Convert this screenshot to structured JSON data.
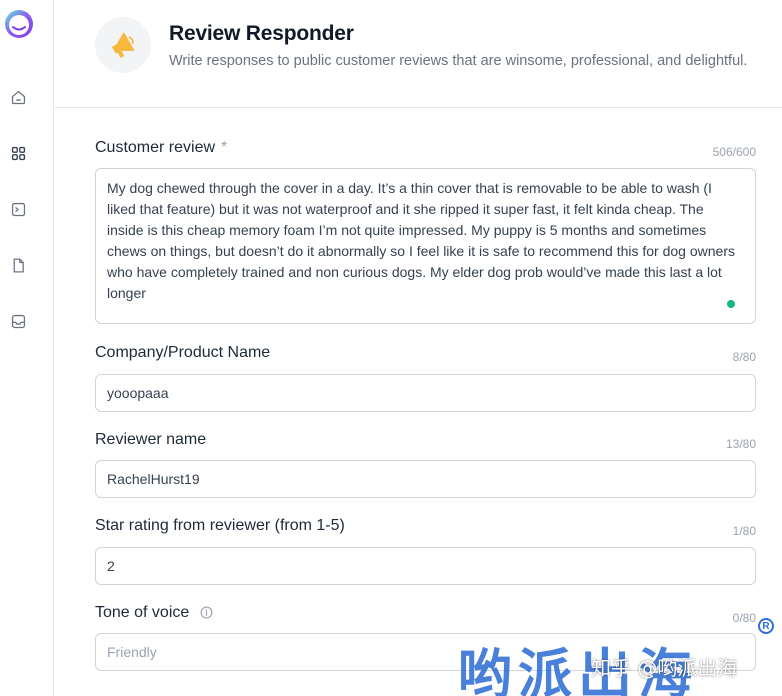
{
  "header": {
    "title": "Review Responder",
    "subtitle": "Write responses to public customer reviews that are winsome, professional, and delightful.",
    "app_icon": "megaphone-icon"
  },
  "sidebar": {
    "logo": "app-logo",
    "items": [
      {
        "icon": "home-icon"
      },
      {
        "icon": "grid-icon"
      },
      {
        "icon": "terminal-icon"
      },
      {
        "icon": "document-icon"
      },
      {
        "icon": "inbox-icon"
      }
    ]
  },
  "form": {
    "customer_review": {
      "label": "Customer review",
      "required_mark": "*",
      "counter": "506/600",
      "value": "My dog chewed through the cover in a day. It’s a thin cover that is removable to be able to wash (I liked that feature) but it was not waterproof and it she ripped it super fast, it felt kinda cheap. The inside is this cheap memory foam I’m not quite impressed. My puppy is 5 months and sometimes chews on things, but doesn’t do it abnormally so I feel like it is safe to recommend this for dog owners who have completely trained and non curious dogs. My elder dog prob would’ve made this last a lot longer"
    },
    "company": {
      "label": "Company/Product Name",
      "counter": "8/80",
      "value": "yooopaaa"
    },
    "reviewer": {
      "label": "Reviewer name",
      "counter": "13/80",
      "value": "RachelHurst19"
    },
    "rating": {
      "label": "Star rating from reviewer (from 1-5)",
      "counter": "1/80",
      "value": "2"
    },
    "tone": {
      "label": "Tone of voice",
      "counter": "0/80",
      "placeholder": "Friendly"
    }
  },
  "watermark": {
    "big_text": "哟派出海",
    "small_text": "知乎 @哟派出海",
    "reg_mark": "R"
  },
  "colors": {
    "accent_yellow": "#f6b93b",
    "logo_purple": "#7c3aed",
    "status_green": "#10b981",
    "watermark_blue": "#2f6fd6"
  }
}
